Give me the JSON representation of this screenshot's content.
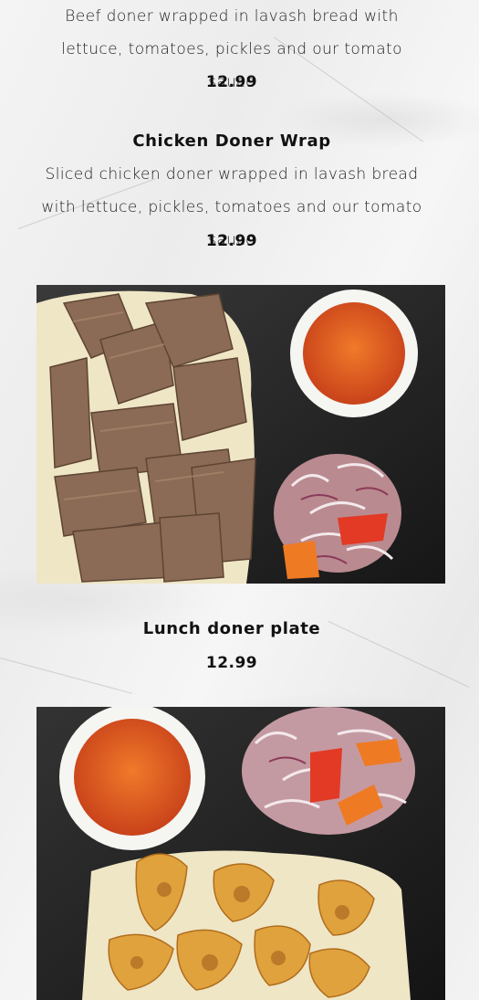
{
  "items": [
    {
      "description": "Beef doner wrapped in lavash bread with lettuce, tomatoes, pickles and our tomato sauce",
      "price": "12.99"
    },
    {
      "name": "Chicken Doner Wrap",
      "description": "Sliced chicken doner wrapped in lavash bread with lettuce, pickles, tomatoes and our tomato sauce",
      "price": "12.99"
    },
    {
      "name": "Lunch doner plate",
      "price": "12.99"
    }
  ],
  "colors": {
    "background": "#f1f1f1",
    "text": "#1a1a1a",
    "tray": "#2b2b2b",
    "sauce": "#e0541c",
    "meat": "#8a6a55",
    "rice": "#f1ead0",
    "chicken": "#e0a23c"
  }
}
